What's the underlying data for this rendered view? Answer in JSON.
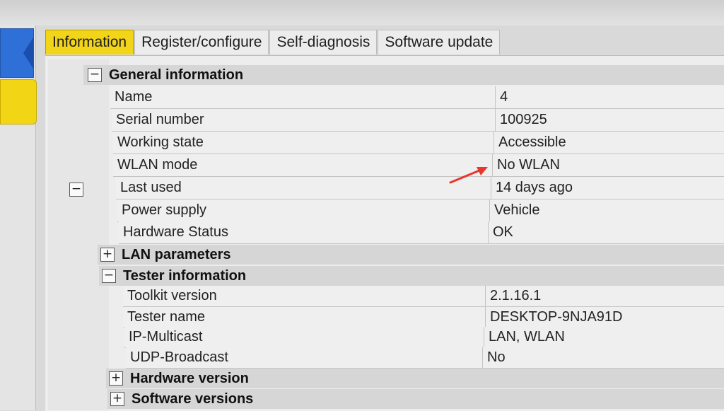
{
  "tabs": [
    "Information",
    "Register/configure",
    "Self-diagnosis",
    "Software update"
  ],
  "sections": {
    "general": {
      "title": "General information",
      "toggle": "−"
    },
    "lan": {
      "title": "LAN parameters",
      "toggle": "+"
    },
    "tester": {
      "title": "Tester information",
      "toggle": "−"
    },
    "hardware": {
      "title": "Hardware version",
      "toggle": "+"
    },
    "software": {
      "title": "Software versions",
      "toggle": "+"
    }
  },
  "general_rows": [
    {
      "label": "Name",
      "value": "4"
    },
    {
      "label": "Serial number",
      "value": "100925"
    },
    {
      "label": "Working state",
      "value": "Accessible"
    },
    {
      "label": "WLAN mode",
      "value": "No WLAN"
    },
    {
      "label": "Last used",
      "value": "14 days ago"
    },
    {
      "label": "Power supply",
      "value": "Vehicle"
    },
    {
      "label": "Hardware Status",
      "value": "OK"
    }
  ],
  "tester_rows": [
    {
      "label": "Toolkit version",
      "value": "2.1.16.1"
    },
    {
      "label": "Tester name",
      "value": "DESKTOP-9NJA91D"
    },
    {
      "label": "IP-Multicast",
      "value": "LAN, WLAN"
    },
    {
      "label": "UDP-Broadcast",
      "value": "No"
    }
  ],
  "outer_toggle": "−",
  "colors": {
    "active_tab": "#f2d418",
    "side_blue": "#2f6fd8",
    "side_yellow": "#f2d514",
    "annotation_arrow": "#e8372c"
  }
}
